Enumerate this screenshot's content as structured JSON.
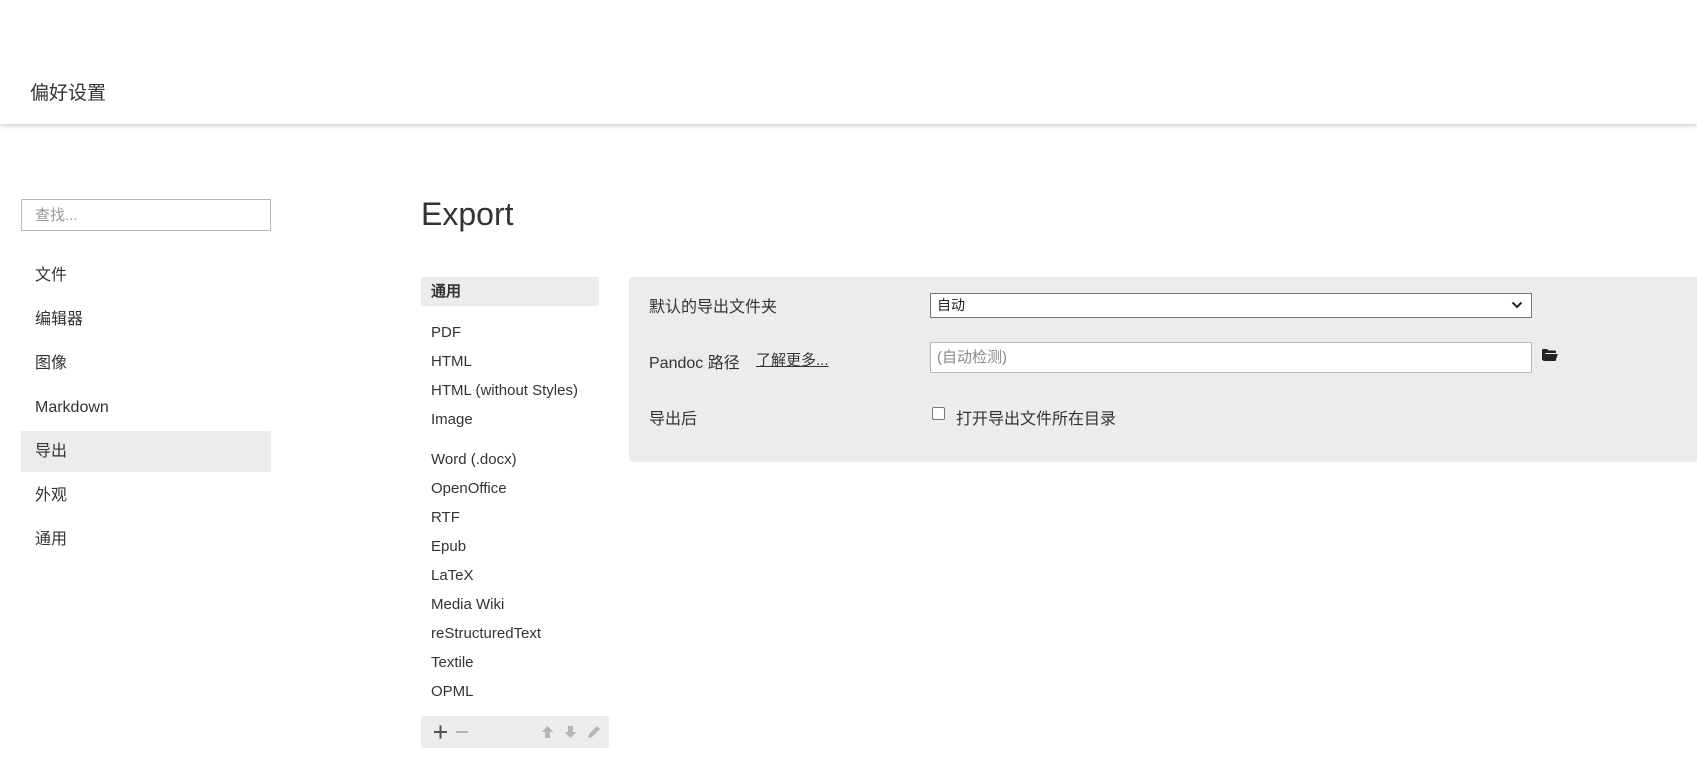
{
  "header": {
    "title": "偏好设置"
  },
  "sidebar": {
    "search_placeholder": "查找...",
    "items": [
      {
        "label": "文件"
      },
      {
        "label": "编辑器"
      },
      {
        "label": "图像"
      },
      {
        "label": "Markdown"
      },
      {
        "label": "导出",
        "active": true
      },
      {
        "label": "外观"
      },
      {
        "label": "通用"
      }
    ]
  },
  "main": {
    "title": "Export",
    "formats": {
      "active": "通用",
      "group1": [
        "PDF",
        "HTML",
        "HTML (without Styles)",
        "Image"
      ],
      "group2": [
        "Word (.docx)",
        "OpenOffice",
        "RTF",
        "Epub",
        "LaTeX",
        "Media Wiki",
        "reStructuredText",
        "Textile",
        "OPML"
      ]
    },
    "toolbar_icons": [
      "plus-icon",
      "minus-icon",
      "arrow-up-icon",
      "arrow-down-icon",
      "pencil-icon"
    ],
    "settings": {
      "default_folder_label": "默认的导出文件夹",
      "default_folder_value": "自动",
      "pandoc_label": "Pandoc 路径",
      "pandoc_link": "了解更多...",
      "pandoc_placeholder": "(自动检测)",
      "after_export_label": "导出后",
      "open_folder_label": "打开导出文件所在目录",
      "open_folder_checked": false
    }
  }
}
